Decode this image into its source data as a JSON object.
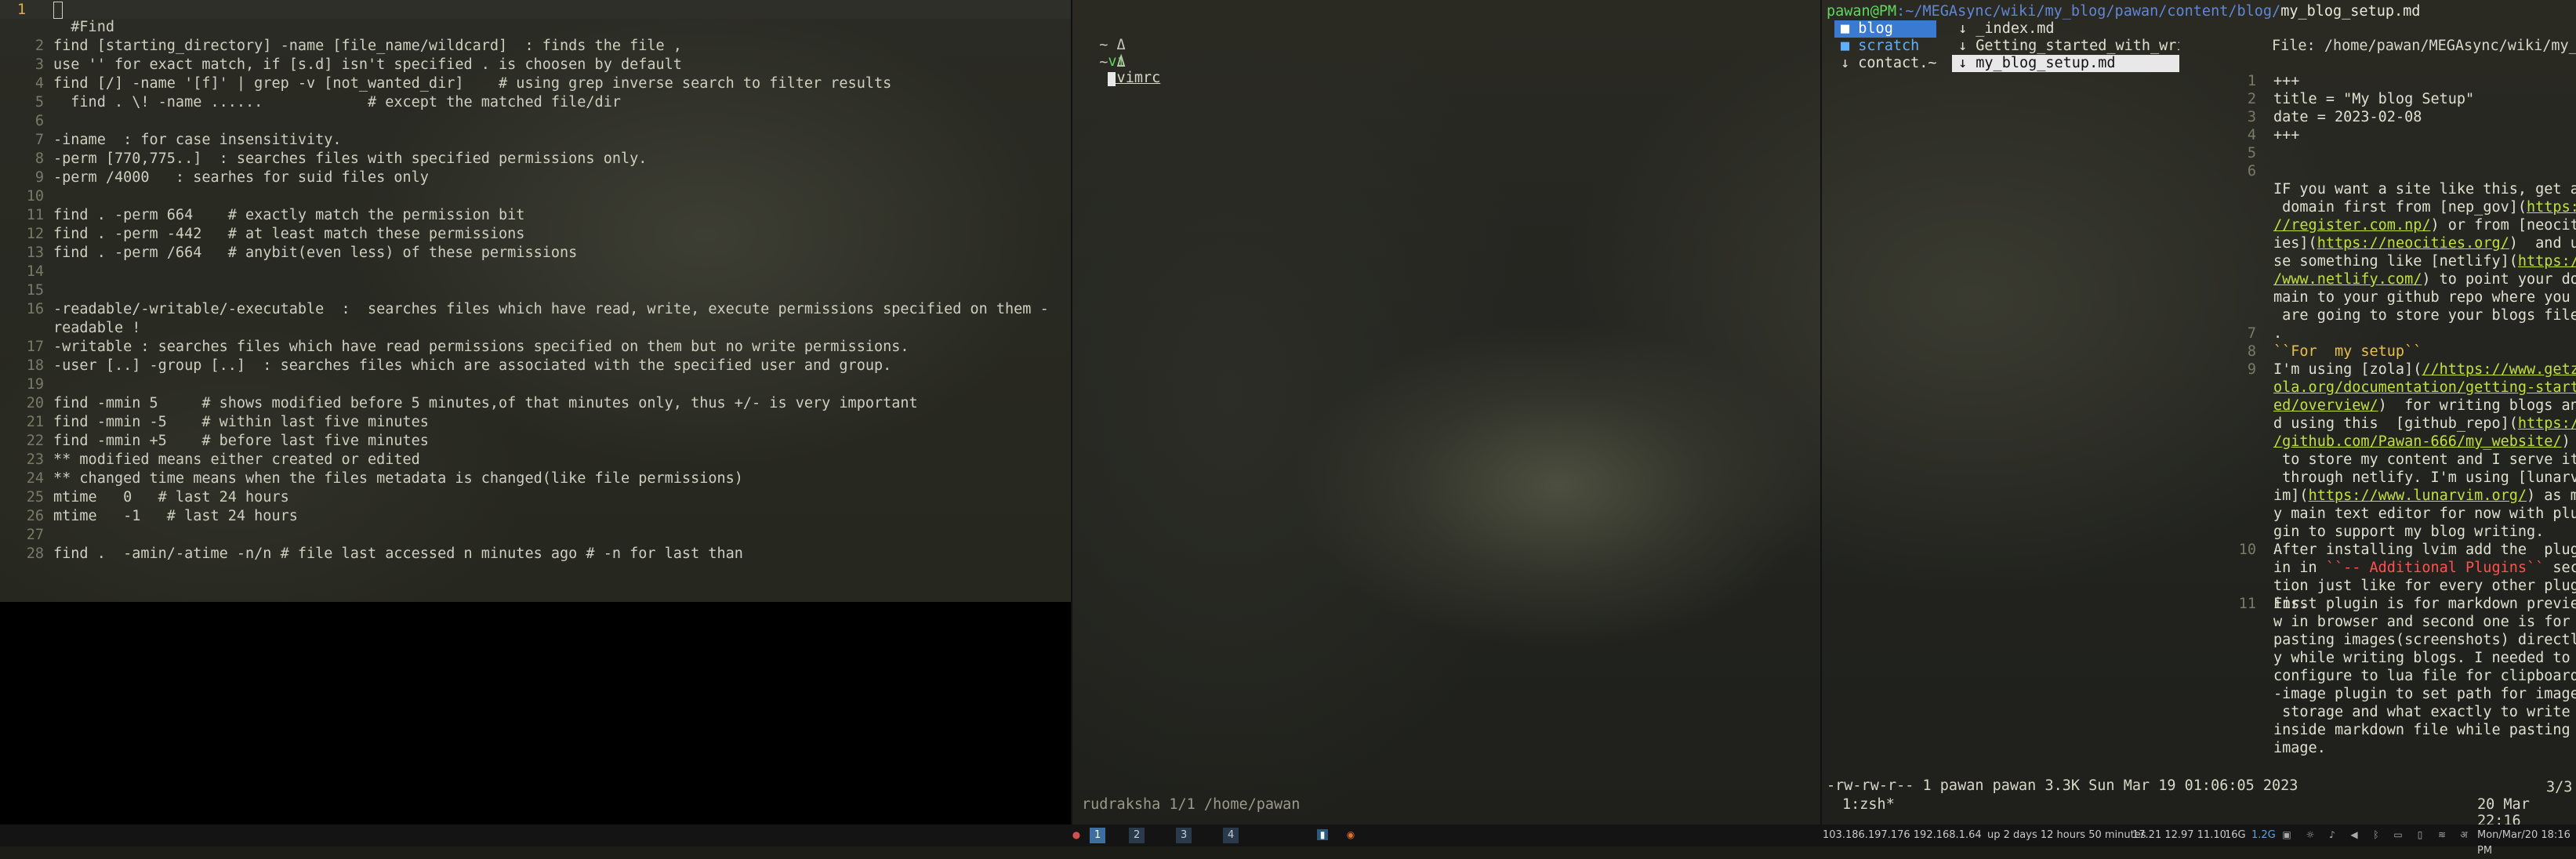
{
  "left": {
    "current_line_number": "1",
    "lines": [
      {
        "n": "2",
        "t": "  #Find"
      },
      {
        "n": "",
        "t": ""
      },
      {
        "n": "2",
        "t": "find [starting_directory] -name [file_name/wildcard]  : finds the file ,"
      },
      {
        "n": "3",
        "t": "use '' for exact match, if [s.d] isn't specified . is choosen by default"
      },
      {
        "n": "4",
        "t": "find [/] -name '[f]' | grep -v [not_wanted_dir]    # using grep inverse search to filter results"
      },
      {
        "n": "5",
        "t": "  find . \\! -name ......            # except the matched file/dir"
      },
      {
        "n": "6",
        "t": ""
      },
      {
        "n": "7",
        "t": "-iname  : for case insensitivity."
      },
      {
        "n": "8",
        "t": "-perm [770,775..]  : searches files with specified permissions only."
      },
      {
        "n": "9",
        "t": "-perm /4000   : searhes for suid files only"
      },
      {
        "n": "10",
        "t": ""
      },
      {
        "n": "11",
        "t": "find . -perm 664    # exactly match the permission bit"
      },
      {
        "n": "12",
        "t": "find . -perm -442   # at least match these permissions"
      },
      {
        "n": "13",
        "t": "find . -perm /664   # anybit(even less) of these permissions"
      },
      {
        "n": "14",
        "t": ""
      },
      {
        "n": "15",
        "t": ""
      },
      {
        "n": "16",
        "t": "-readable/-writable/-executable  :  searches files which have read, write, execute permissions specified on them -"
      },
      {
        "n": "",
        "t": "readable !"
      },
      {
        "n": "17",
        "t": "-writable : searches files which have read permissions specified on them but no write permissions."
      },
      {
        "n": "18",
        "t": "-user [..] -group [..]  : searches files which are associated with the specified user and group."
      },
      {
        "n": "19",
        "t": ""
      },
      {
        "n": "20",
        "t": "find -mmin 5     # shows modified before 5 minutes,of that minutes only, thus +/- is very important"
      },
      {
        "n": "21",
        "t": "find -mmin -5    # within last five minutes"
      },
      {
        "n": "22",
        "t": "find -mmin +5    # before last five minutes"
      },
      {
        "n": "23",
        "t": "** modified means either created or edited"
      },
      {
        "n": "24",
        "t": "** changed time means when the files metadata is changed(like file permissions)"
      },
      {
        "n": "25",
        "t": "mtime   0   # last 24 hours"
      },
      {
        "n": "26",
        "t": "mtime   -1   # last 24 hours"
      },
      {
        "n": "27",
        "t": ""
      },
      {
        "n": "28",
        "t": "find .  -amin/-atime -n/n # file last accessed n minutes ago # -n for last than"
      }
    ]
  },
  "middle": {
    "prompt_symbol": "~ Δ",
    "cmd": "vi",
    "arg": ".vimrc",
    "status": "rudraksha 1/1 /home/pawan"
  },
  "right": {
    "path_user": "pawan@PM",
    "path_dir": ":~/MEGAsync/wiki/my_blog/pawan/content/blog/",
    "path_file": "my_blog_setup.md",
    "col1": [
      {
        "label": "■ blog",
        "kind": "sel1"
      },
      {
        "label": "■ scratch",
        "kind": "dir"
      },
      {
        "label": "↓ contact.~",
        "kind": "file"
      }
    ],
    "col2": [
      {
        "label": "↓ _index.md",
        "kind": "file"
      },
      {
        "label": "↓ Getting_started_with_wri~",
        "kind": "file"
      },
      {
        "label": "↓ my_blog_setup.md",
        "kind": "sel2"
      }
    ],
    "file_header": "File: /home/pawan/MEGAsync/wiki/my_blo",
    "bottom_info": "-rw-rw-r-- 1 pawan pawan 3.3K Sun Mar 19 01:06:05 2023",
    "zsh": "1:zsh*",
    "page": "3/3",
    "date": "20 Mar 22:16"
  },
  "taskbar": {
    "workspaces": [
      "1",
      "2",
      "3",
      "4"
    ],
    "net": "103.186.197.176 192.168.1.64",
    "uptime": "up 2 days 12 hours 50 minutes",
    "load": "17.21 12.97 11.10",
    "mem": "16G",
    "swap": "1.2G",
    "clock": "Mon/Mar/20 18:16 PM"
  }
}
